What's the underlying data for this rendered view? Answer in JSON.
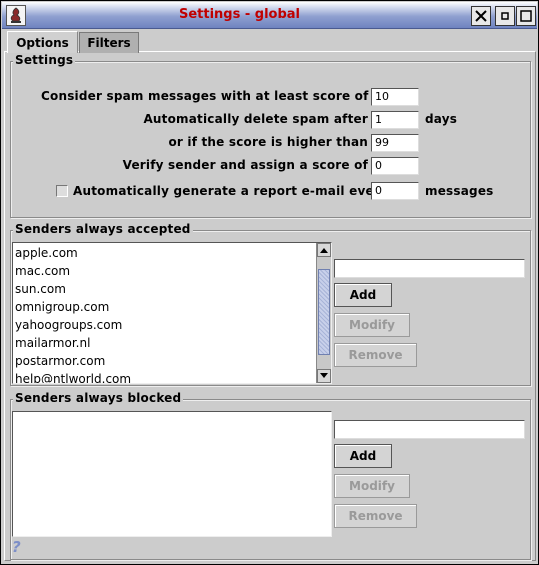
{
  "window": {
    "title": "Settings - global"
  },
  "tabs": [
    {
      "label": "Options"
    },
    {
      "label": "Filters"
    }
  ],
  "settings": {
    "group_title": "Settings",
    "min_score_label": "Consider spam messages with at least score of",
    "min_score_value": "10",
    "delete_after_label": "Automatically delete spam after",
    "delete_after_value": "1",
    "delete_after_unit": "days",
    "score_higher_label": "or if the score is higher than",
    "score_higher_value": "99",
    "verify_label": "Verify sender and assign a score of",
    "verify_value": "0",
    "report_label": "Automatically generate a report e-mail every",
    "report_value": "0",
    "report_unit": "messages",
    "report_checked": false
  },
  "accepted": {
    "group_title": "Senders always accepted",
    "items": [
      "apple.com",
      "mac.com",
      "sun.com",
      "omnigroup.com",
      "yahoogroups.com",
      "mailarmor.nl",
      "postarmor.com",
      "help@ntlworld.com"
    ],
    "input_value": "",
    "add_label": "Add",
    "modify_label": "Modify",
    "remove_label": "Remove",
    "scroll_position": 0.45
  },
  "blocked": {
    "group_title": "Senders always blocked",
    "items": [],
    "input_value": "",
    "add_label": "Add",
    "modify_label": "Modify",
    "remove_label": "Remove"
  },
  "help": {
    "glyph": "?"
  },
  "colors": {
    "title_text": "#c00000",
    "window_bg": "#cccccc",
    "scroll_thumb": "#a8b4d8"
  }
}
